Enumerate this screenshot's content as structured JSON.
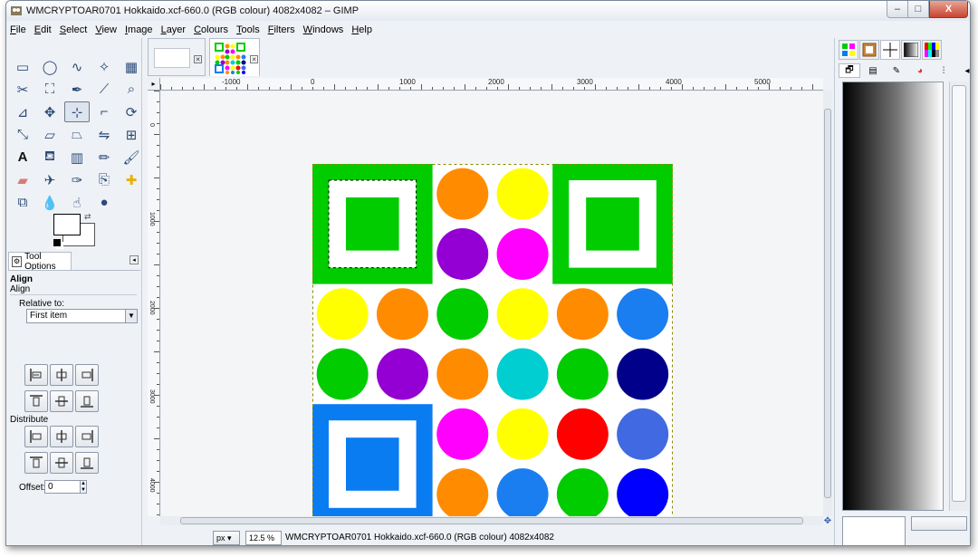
{
  "window": {
    "title": "WMCRYPTOAR0701 Hokkaido.xcf-660.0 (RGB colour) 4082x4082 – GIMP",
    "min_label": "–",
    "max_label": "□",
    "close_label": "X"
  },
  "menu": [
    "File",
    "Edit",
    "Select",
    "View",
    "Image",
    "Layer",
    "Colours",
    "Tools",
    "Filters",
    "Windows",
    "Help"
  ],
  "toolbox": {
    "tools": [
      "rect-select",
      "ellipse-select",
      "free-select",
      "fuzzy-select",
      "select-by-color",
      "scissors",
      "foreground-select",
      "paths",
      "color-picker",
      "zoom",
      "measure",
      "move",
      "align",
      "crop",
      "rotate",
      "scale",
      "shear",
      "perspective",
      "flip",
      "cage",
      "text",
      "bucket-fill",
      "blend",
      "pencil",
      "paintbrush",
      "eraser",
      "airbrush",
      "ink",
      "clone",
      "heal",
      "perspective-clone",
      "blur",
      "smudge",
      "dodge-burn"
    ],
    "active_tool": "align",
    "fg_color": "#ffffff",
    "bg_color": "#ffffff"
  },
  "tool_options": {
    "tab_label": "Tool Options",
    "title": "Align",
    "subtitle": "Align",
    "relative_to_label": "Relative to:",
    "relative_to_value": "First item",
    "distribute_label": "Distribute",
    "offset_label": "Offset:",
    "offset_value": "0"
  },
  "image_tabs": [
    {
      "name": "blank-image",
      "active": false
    },
    {
      "name": "hokkaido-image",
      "active": true
    }
  ],
  "ruler": {
    "top_labels": [
      "-1000",
      "0",
      "1000",
      "2000",
      "3000",
      "4000",
      "5000"
    ],
    "left_labels": [
      "0",
      "1000",
      "2000",
      "3000",
      "4000"
    ]
  },
  "image": {
    "bg": "#ffffff",
    "squares": [
      {
        "color": "#00cc00",
        "pos": "top-left"
      },
      {
        "color": "#00cc00",
        "pos": "top-right"
      },
      {
        "color": "#0a7cf2",
        "pos": "bottom-left"
      }
    ],
    "circles": [
      [
        "",
        "",
        "#ff8c00",
        "#ffff00",
        "",
        ""
      ],
      [
        "",
        "",
        "#9400d3",
        "#ff00ff",
        "",
        ""
      ],
      [
        "#ffff00",
        "#ff8c00",
        "#00cc00",
        "#ffff00",
        "#ff8c00",
        "#1a7ef0"
      ],
      [
        "#00cc00",
        "#9400d3",
        "#ff8c00",
        "#00ced1",
        "#00cc00",
        "#00008b"
      ],
      [
        "",
        "",
        "#ff00ff",
        "#ffff00",
        "#ff0000",
        "#4169e1"
      ],
      [
        "",
        "",
        "#ff8c00",
        "#1a7ef0",
        "#00cc00",
        "#0000ff"
      ]
    ]
  },
  "status": {
    "unit": "px",
    "zoom": "12.5 %",
    "message": "WMCRYPTOAR0701 Hokkaido.xcf-660.0 (RGB colour) 4082x4082"
  },
  "dock": {
    "tabs": [
      "patterns-tab",
      "brushes-tab",
      "crosshair-tab",
      "gradients-tab",
      "palettes-tab"
    ],
    "active_tab": "gradients-tab",
    "subtabs": [
      "layers-subtab",
      "channels-subtab",
      "paths-subtab",
      "colormap-subtab",
      "histogram-subtab",
      "undo-subtab"
    ]
  }
}
